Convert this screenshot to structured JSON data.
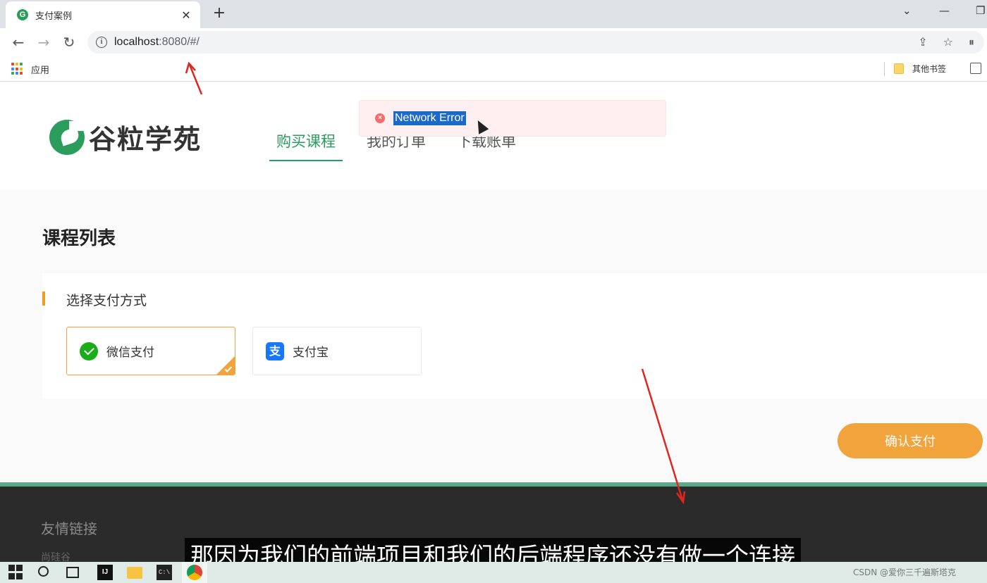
{
  "browser": {
    "tab_title": "支付案例",
    "tab_favicon": "G",
    "tab_close": "✕",
    "new_tab": "+",
    "url_host": "localhost",
    "url_rest": ":8080/#/",
    "back_icon": "←",
    "forward_icon": "→",
    "reload_icon": "↻",
    "info_icon": "i",
    "omnibox_icons": [
      "share-icon",
      "star-icon",
      "profile-icon"
    ],
    "omnibox_glyphs": [
      "⇪",
      "☆",
      "⏸"
    ],
    "bookmarks_apps_label": "应用",
    "other_bookmarks_label": "其他书签",
    "window_controls": [
      "⌄",
      "—",
      "❐"
    ]
  },
  "site": {
    "logo_text": "谷粒学苑",
    "nav": [
      {
        "label": "购买课程",
        "active": true
      },
      {
        "label": "我的订单",
        "active": false
      },
      {
        "label": "下载账单",
        "active": false
      }
    ]
  },
  "toast": {
    "type": "error",
    "icon": "×",
    "message": "Network Error"
  },
  "main": {
    "section_title": "课程列表",
    "payment_card": {
      "title": "选择支付方式",
      "options": [
        {
          "label": "微信支付",
          "icon": "wechat-icon",
          "selected": true
        },
        {
          "label": "支付宝",
          "icon": "alipay-icon",
          "icon_glyph": "支",
          "selected": false
        }
      ]
    },
    "confirm_label": "确认支付"
  },
  "footer": {
    "title": "友情链接",
    "link": "尚硅谷"
  },
  "subtitle": "那因为我们的前端项目和我们的后端程序还没有做一个连接",
  "taskbar": {
    "ij_label": "IJ",
    "cmd_label": "C:\\"
  },
  "watermark": "CSDN @爱你三千遍斯塔克",
  "colors": {
    "brand_green": "#2a9d5c",
    "accent_orange": "#f0a43b",
    "error_red": "#f56c6c",
    "footer_bg": "#2b2b2b"
  }
}
